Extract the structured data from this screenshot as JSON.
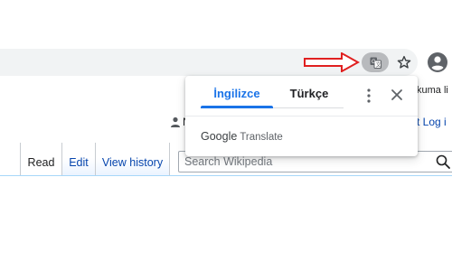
{
  "browser": {
    "translate_button": "translate-icon",
    "bookmark": "star-icon",
    "profile": "profile-icon"
  },
  "annotation": {
    "arrow_color": "#e02020"
  },
  "popup": {
    "tabs": [
      {
        "label": "İngilizce",
        "selected": true
      },
      {
        "label": "Türkçe",
        "selected": false
      }
    ],
    "brand_google": "Google",
    "brand_translate": "Translate",
    "accent": "#1a73e8"
  },
  "wiki": {
    "top_link_partial": "kuma li",
    "user_partial": "N",
    "login_partial": "t  Log i",
    "tabs": {
      "read": "Read",
      "edit": "Edit",
      "history": "View history"
    },
    "search": {
      "placeholder": "Search Wikipedia"
    }
  }
}
